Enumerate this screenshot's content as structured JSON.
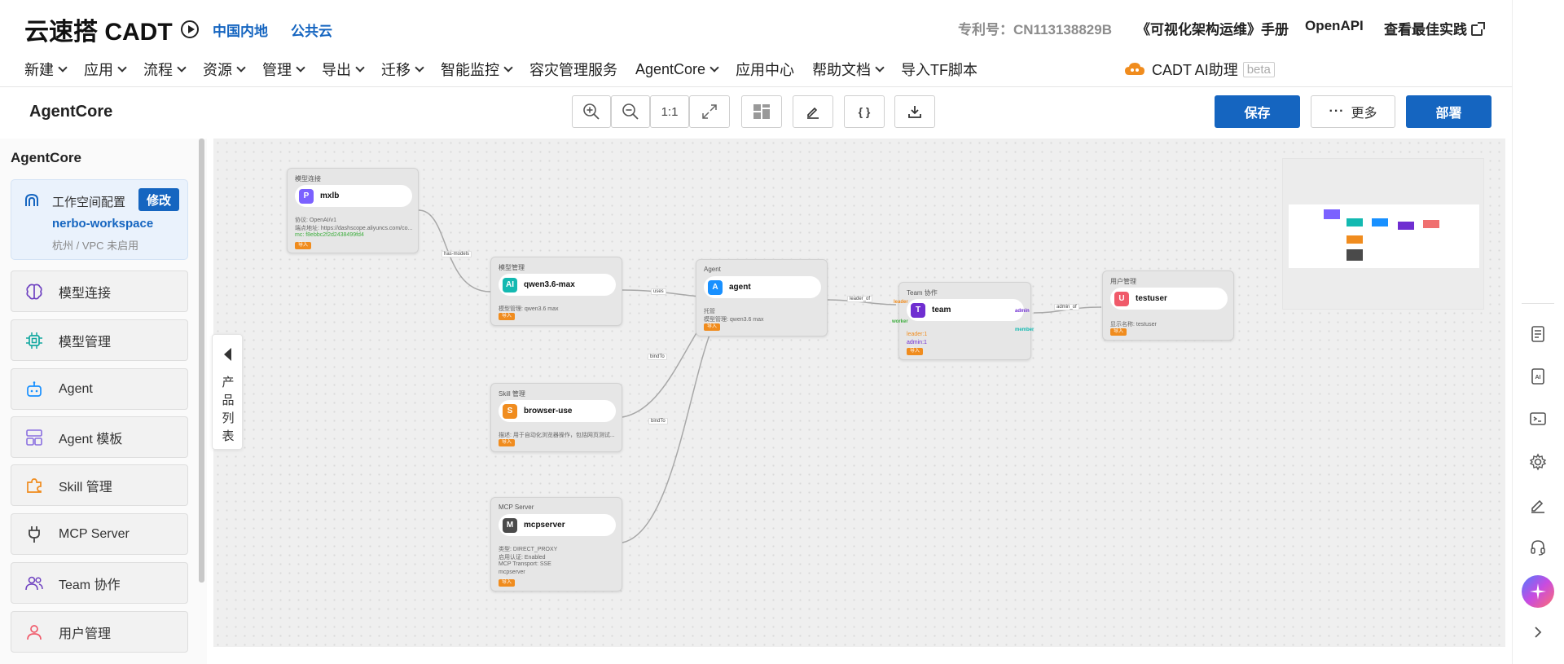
{
  "header": {
    "brand": "云速搭 CADT",
    "regions": [
      "中国内地",
      "公共云"
    ],
    "patent": "专利号：CN113138829B",
    "manual": "《可视化架构运维》手册",
    "openapi": "OpenAPI",
    "best_practice": "查看最佳实践"
  },
  "menu": [
    {
      "label": "新建",
      "has_dropdown": true
    },
    {
      "label": "应用",
      "has_dropdown": true
    },
    {
      "label": "流程",
      "has_dropdown": true
    },
    {
      "label": "资源",
      "has_dropdown": true
    },
    {
      "label": "管理",
      "has_dropdown": true
    },
    {
      "label": "导出",
      "has_dropdown": true
    },
    {
      "label": "迁移",
      "has_dropdown": true
    },
    {
      "label": "智能监控",
      "has_dropdown": true
    },
    {
      "label": "容灾管理服务",
      "has_dropdown": false
    },
    {
      "label": "AgentCore",
      "has_dropdown": true
    },
    {
      "label": "应用中心",
      "has_dropdown": false
    },
    {
      "label": "帮助文档",
      "has_dropdown": true
    },
    {
      "label": "导入TF脚本",
      "has_dropdown": false
    }
  ],
  "ai_assistant": {
    "label": "CADT AI助理",
    "badge": "beta"
  },
  "toolbar": {
    "title": "AgentCore",
    "zoom_label": "1:1",
    "json_label": "{ }",
    "save": "保存",
    "more": "更多",
    "deploy": "部署"
  },
  "sidebar": {
    "title": "AgentCore",
    "workspace": {
      "label": "工作空间配置",
      "edit": "修改",
      "name": "nerbo-workspace",
      "sub": "杭州 / VPC 未启用"
    },
    "items": [
      {
        "label": "模型连接",
        "icon": "brain-icon"
      },
      {
        "label": "模型管理",
        "icon": "chip-icon"
      },
      {
        "label": "Agent",
        "icon": "robot-icon"
      },
      {
        "label": "Agent 模板",
        "icon": "template-icon"
      },
      {
        "label": "Skill 管理",
        "icon": "puzzle-icon"
      },
      {
        "label": "MCP Server",
        "icon": "plug-icon"
      },
      {
        "label": "Team 协作",
        "icon": "team-icon"
      },
      {
        "label": "用户管理",
        "icon": "user-icon"
      }
    ],
    "collapse_label": "产品列表"
  },
  "nodes": {
    "mxlb": {
      "category": "模型连接",
      "badge": "P",
      "badge_color": "#7b61ff",
      "name": "mxlb",
      "lines": [
        "协议: OpenAI/v1",
        "端点地址: https://dashscope.aliyuncs.com/co...",
        "mc: f8ebbc2f2d2438499fd4"
      ],
      "tag": "导入"
    },
    "qwen": {
      "category": "模型管理",
      "badge": "AI",
      "badge_color": "#13b9b1",
      "name": "qwen3.6-max",
      "lines": [
        "模型管理: qwen3.6 max"
      ],
      "tag": "导入"
    },
    "skill": {
      "category": "Skill 管理",
      "badge": "S",
      "badge_color": "#f08c1e",
      "name": "browser-use",
      "lines": [
        "描述: 用于自动化浏览器操作，包括网页测试..."
      ],
      "tag": "导入"
    },
    "mcp": {
      "category": "MCP Server",
      "badge": "M",
      "badge_color": "#4a4a4a",
      "name": "mcpserver",
      "lines": [
        "类型: DIRECT_PROXY",
        "启用认证: Enabled",
        "MCP Transport: SSE",
        "mcpserver"
      ],
      "tag": "导入"
    },
    "agent": {
      "category": "Agent",
      "badge": "A",
      "badge_color": "#1890ff",
      "name": "agent",
      "lines": [
        "托管",
        "模型管理: qwen3.6 max"
      ],
      "tag": "导入"
    },
    "team": {
      "category": "Team 协作",
      "badge": "T",
      "badge_color": "#6f2ed1",
      "name": "team",
      "lines": [
        "leader:1",
        "admin:1"
      ],
      "tag": "导入",
      "ports": {
        "leader": "leader",
        "worker": "worker",
        "admin": "admin",
        "member": "member"
      }
    },
    "user": {
      "category": "用户管理",
      "badge": "U",
      "badge_color": "#f05a6a",
      "name": "testuser",
      "lines": [
        "显示名称: testuser"
      ],
      "tag": "导入"
    }
  },
  "edge_labels": {
    "has_models": "has-models",
    "uses": "uses",
    "bind_skill": "bindTo",
    "bind_mcp": "bindTo",
    "leader_of": "leader_of",
    "admin_of": "admin_of"
  },
  "minimap_colors": [
    "#7b61ff",
    "#13b9b1",
    "#1890ff",
    "#6f2ed1",
    "#f07070",
    "#f08c1e",
    "#4a4a4a"
  ]
}
